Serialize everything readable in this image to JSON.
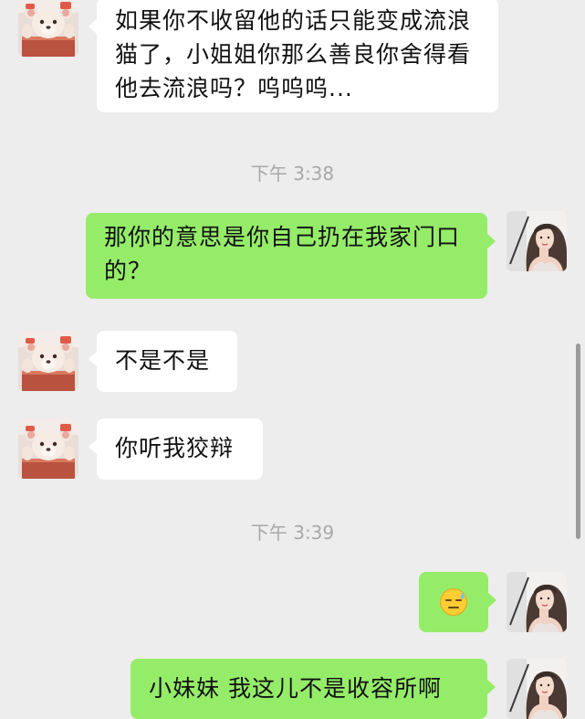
{
  "messages": [
    {
      "side": "in",
      "text": "如果你不收留他的话只能变成流浪猫了，小姐姐你那么善良你舍得看他去流浪吗？呜呜呜..."
    },
    {
      "timestamp": "下午 3:38"
    },
    {
      "side": "out",
      "text": "那你的意思是你自己扔在我家门口的？"
    },
    {
      "side": "in",
      "text": "不是不是"
    },
    {
      "side": "in",
      "text": "你听我狡辩"
    },
    {
      "timestamp": "下午 3:39"
    },
    {
      "side": "out",
      "emoji": "😓"
    },
    {
      "side": "out",
      "text": "小妹妹 我这儿不是收容所啊"
    }
  ],
  "avatars": {
    "other": "teddy-bear-avatar",
    "self": "woman-portrait-avatar"
  },
  "colors": {
    "background": "#ededed",
    "incoming_bubble": "#ffffff",
    "outgoing_bubble": "#95ec69",
    "timestamp": "#a8a8a8"
  }
}
